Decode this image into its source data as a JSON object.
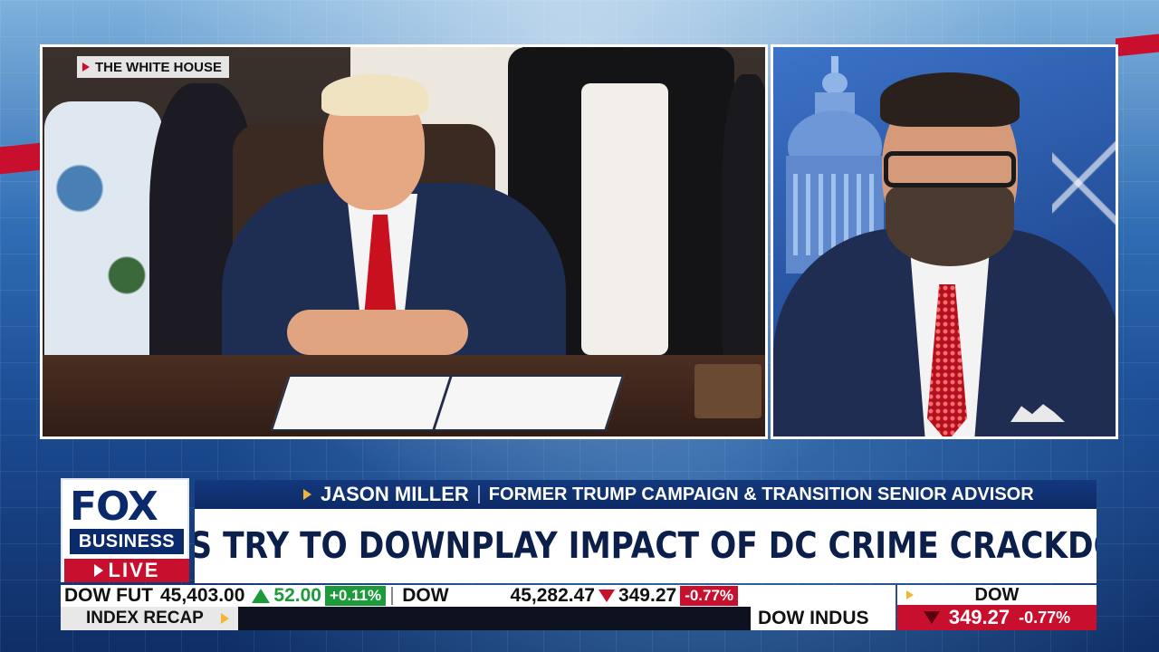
{
  "location_tag": "THE WHITE HOUSE",
  "logo": {
    "fox": "FOX",
    "business": "BUSINESS",
    "live": "LIVE"
  },
  "nameplate": {
    "name": "JASON MILLER",
    "title": "FORMER TRUMP CAMPAIGN & TRANSITION SENIOR ADVISOR"
  },
  "headline": "DEMS TRY TO DOWNPLAY IMPACT OF DC CRIME CRACKDOWN",
  "ticker": {
    "dow_fut_label": "DOW FUT",
    "dow_fut_value": "45,403.00",
    "dow_fut_change": "52.00",
    "dow_fut_pct": "+0.11%",
    "dow_label": "DOW",
    "dow_value": "45,282.47",
    "dow_change": "349.27",
    "dow_pct": "-0.77%",
    "recap_label": "INDEX RECAP",
    "crawl_text": "DOW INDUS"
  },
  "index_box": {
    "label": "DOW",
    "change": "349.27",
    "pct": "-0.77%"
  },
  "colors": {
    "brand_navy": "#0b2a6b",
    "live_red": "#c8102e",
    "up_green": "#1d9a3a",
    "accent_gold": "#f2b632"
  }
}
